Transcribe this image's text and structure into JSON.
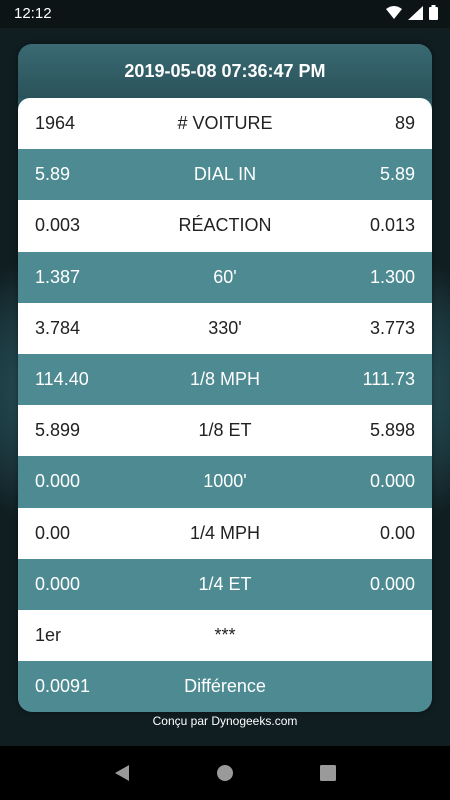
{
  "status": {
    "time": "12:12",
    "icons": [
      "wifi-icon",
      "signal-icon",
      "battery-icon"
    ]
  },
  "header": {
    "datetime": "2019-05-08 07:36:47 PM"
  },
  "rows": [
    {
      "left": "1964",
      "label": "# VOITURE",
      "right": "89"
    },
    {
      "left": "5.89",
      "label": "DIAL IN",
      "right": "5.89"
    },
    {
      "left": "0.003",
      "label": "RÉACTION",
      "right": "0.013"
    },
    {
      "left": "1.387",
      "label": "60'",
      "right": "1.300"
    },
    {
      "left": "3.784",
      "label": "330'",
      "right": "3.773"
    },
    {
      "left": "114.40",
      "label": "1/8 MPH",
      "right": "111.73"
    },
    {
      "left": "5.899",
      "label": "1/8 ET",
      "right": "5.898"
    },
    {
      "left": "0.000",
      "label": "1000'",
      "right": "0.000"
    },
    {
      "left": "0.00",
      "label": "1/4 MPH",
      "right": "0.00"
    },
    {
      "left": "0.000",
      "label": "1/4 ET",
      "right": "0.000"
    },
    {
      "left": "1er",
      "label": "***",
      "right": ""
    },
    {
      "left": "0.0091",
      "label": "Différence",
      "right": ""
    }
  ],
  "footer": {
    "credit": "Conçu par Dynogeeks.com"
  },
  "nav": {
    "icons": [
      "back-icon",
      "home-icon",
      "recents-icon"
    ]
  },
  "colors": {
    "row_light": "#ffffff",
    "row_dark": "#4d8a92",
    "header_bg": "#2d5961"
  }
}
